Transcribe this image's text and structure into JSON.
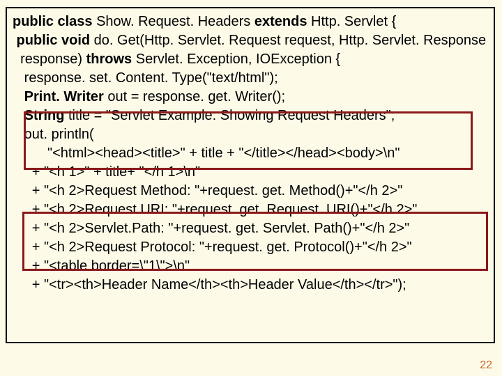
{
  "code": {
    "l1a": "public class ",
    "l1b": "Show. Request. Headers ",
    "l1c": "extends ",
    "l1d": "Http. Servlet {",
    "l2a": " public void ",
    "l2b": "do. Get(Http. Servlet. Request request, Http. Servlet. Response",
    "l3a": "  response) ",
    "l3b": "throws ",
    "l3c": "Servlet. Exception, IOException {",
    "l4": "",
    "l5": "   response. set. Content. Type(\"text/html\");",
    "l6a": "   Print. Writer ",
    "l6b": "out = response. get. Writer();",
    "l7a": "   String ",
    "l7b": "title = \"Servlet Example: Showing Request Headers\";",
    "l8": "   out. println(",
    "l9": "         \"<html><head><title>\" + title + \"</title></head><body>\\n\"",
    "l10": "     + \"<h 1>\" + title+ \"</h 1>\\n\"",
    "l11": "     + \"<h 2>Request Method: \"+request. get. Method()+\"</h 2>\"",
    "l12": "     + \"<h 2>Request URI: \"+request. get. Request. URI()+\"</h 2>\"",
    "l13": "     + \"<h 2>Servlet.Path: \"+request. get. Servlet. Path()+\"</h 2>\"",
    "l14": "     + \"<h 2>Request Protocol: \"+request. get. Protocol()+\"</h 2>\"",
    "l15": "     + \"<table border=\\\"1\\\">\\n\"",
    "l16": "     + \"<tr><th>Header Name</th><th>Header Value</th></tr>\");"
  },
  "page_number": "22"
}
